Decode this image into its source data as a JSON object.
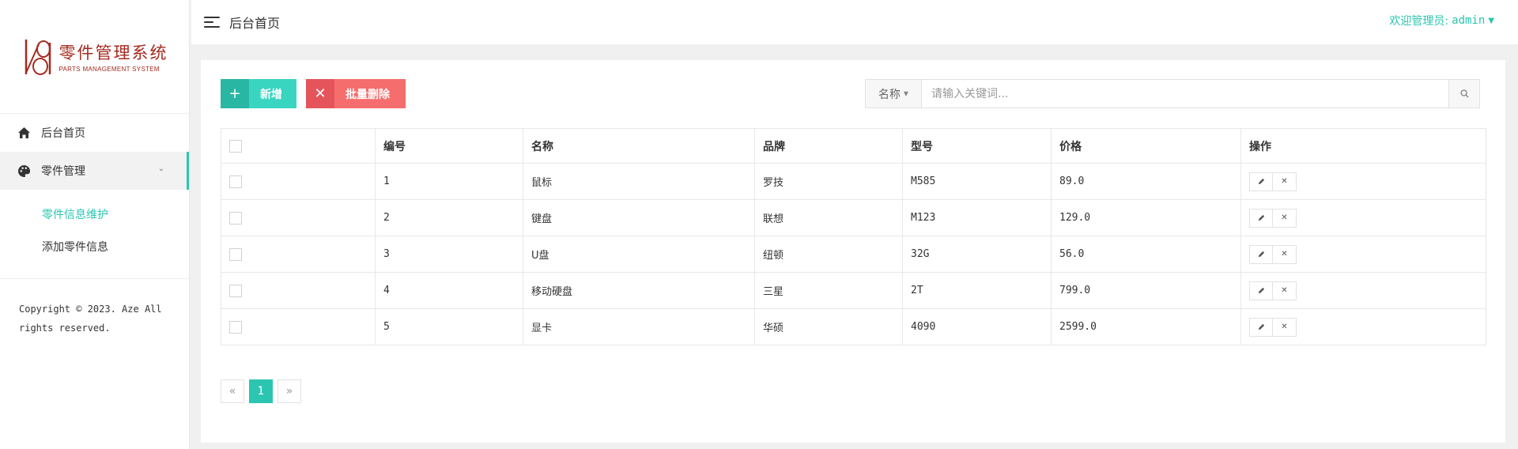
{
  "logo": {
    "title": "零件管理系统",
    "subtitle": "PARTS MANAGEMENT SYSTEM"
  },
  "sidebar": {
    "items": [
      {
        "label": "后台首页",
        "icon": "home-icon"
      },
      {
        "label": "零件管理",
        "icon": "palette-icon",
        "expanded": true
      }
    ],
    "sub_items": [
      {
        "label": "零件信息维护",
        "active": true
      },
      {
        "label": "添加零件信息",
        "active": false
      }
    ],
    "copyright": "Copyright © 2023. Aze All rights reserved."
  },
  "header": {
    "title": "后台首页",
    "welcome": "欢迎管理员:",
    "username": "admin"
  },
  "toolbar": {
    "add_label": "新增",
    "batch_delete_label": "批量删除"
  },
  "search": {
    "field_selected": "名称",
    "placeholder": "请输入关键词..."
  },
  "table": {
    "columns": [
      "编号",
      "名称",
      "品牌",
      "型号",
      "价格",
      "操作"
    ],
    "rows": [
      {
        "id": "1",
        "name": "鼠标",
        "brand": "罗技",
        "model": "M585",
        "price": "89.0"
      },
      {
        "id": "2",
        "name": "键盘",
        "brand": "联想",
        "model": "M123",
        "price": "129.0"
      },
      {
        "id": "3",
        "name": "U盘",
        "brand": "纽顿",
        "model": "32G",
        "price": "56.0"
      },
      {
        "id": "4",
        "name": "移动硬盘",
        "brand": "三星",
        "model": "2T",
        "price": "799.0"
      },
      {
        "id": "5",
        "name": "显卡",
        "brand": "华硕",
        "model": "4090",
        "price": "2599.0"
      }
    ]
  },
  "pagination": {
    "prev": "«",
    "current": "1",
    "next": "»"
  },
  "colors": {
    "accent": "#2bc5b1",
    "danger": "#f66d6d",
    "brand": "#a52a1f"
  }
}
